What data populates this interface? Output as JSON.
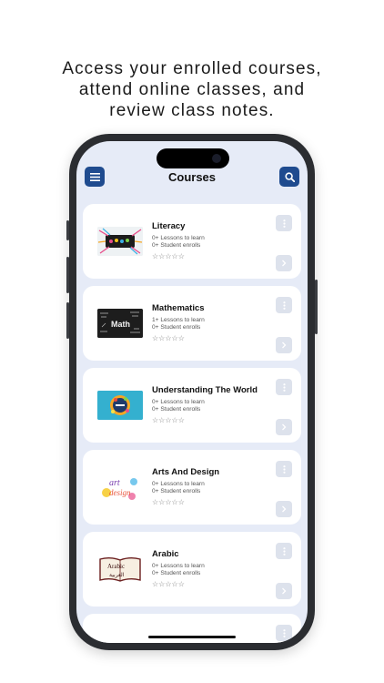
{
  "headline": {
    "line1": "Access your enrolled courses,",
    "line2": "attend online classes, and",
    "line3": "review class notes."
  },
  "header": {
    "title": "Courses",
    "menu_icon": "menu-icon",
    "search_icon": "search-icon"
  },
  "colors": {
    "accent": "#1f4b8f",
    "screen_bg": "#e6ebf7",
    "card_bg": "#ffffff",
    "button_bg": "#dde2ec"
  },
  "courses": [
    {
      "name": "Literacy",
      "lessons": "0+ Lessons to learn",
      "students": "0+ Student enrolls",
      "stars": "☆☆☆☆☆"
    },
    {
      "name": "Mathematics",
      "lessons": "1+ Lessons to learn",
      "students": "0+ Student enrolls",
      "stars": "☆☆☆☆☆"
    },
    {
      "name": "Understanding The World",
      "lessons": "0+ Lessons to learn",
      "students": "0+ Student enrolls",
      "stars": "☆☆☆☆☆"
    },
    {
      "name": "Arts And Design",
      "lessons": "0+ Lessons to learn",
      "students": "0+ Student enrolls",
      "stars": "☆☆☆☆☆"
    },
    {
      "name": "Arabic",
      "lessons": "0+ Lessons to learn",
      "students": "0+ Student enrolls",
      "stars": "☆☆☆☆☆"
    }
  ],
  "thumbs": {
    "math_text": "Math",
    "art_text": "art",
    "design_text": "design",
    "arabic_text": "Arabic",
    "arabic_script": "العربية"
  }
}
